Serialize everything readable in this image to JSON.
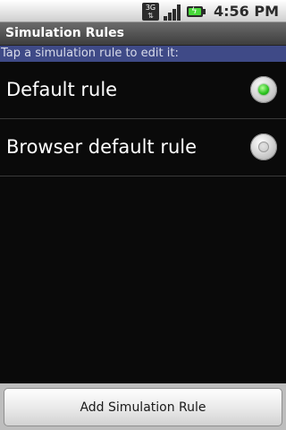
{
  "status_bar": {
    "network_type": "3G",
    "signal_icon": "signal-strength-icon",
    "battery_icon": "battery-charging-icon",
    "time": "4:56 PM"
  },
  "title_bar": {
    "title": "Simulation Rules"
  },
  "instruction": "Tap a simulation rule to edit it:",
  "rules": [
    {
      "label": "Default rule",
      "selected": true
    },
    {
      "label": "Browser default rule",
      "selected": false
    }
  ],
  "footer": {
    "add_button_label": "Add Simulation Rule"
  },
  "colors": {
    "instruction_bg": "#3f4a87",
    "radio_selected": "#27c21c"
  }
}
